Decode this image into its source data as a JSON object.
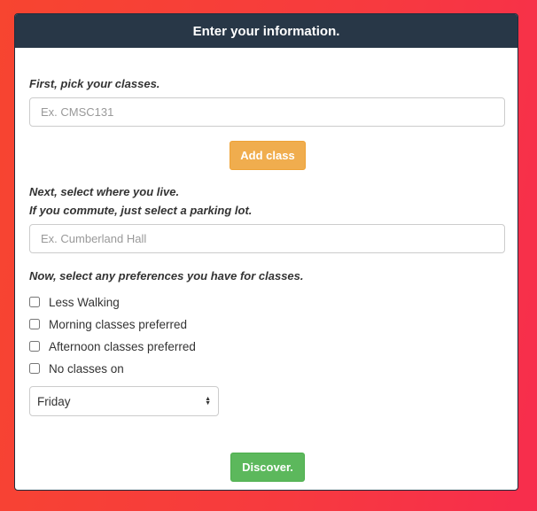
{
  "form": {
    "title": "Enter your information.",
    "classes_label": "First, pick your classes.",
    "classes_placeholder": "Ex. CMSC131",
    "add_class_label": "Add class",
    "residence_label_line1": "Next, select where you live.",
    "residence_label_line2": "If you commute, just select a parking lot.",
    "residence_placeholder": "Ex. Cumberland Hall",
    "preferences_label": "Now, select any preferences you have for classes.",
    "preferences": [
      {
        "label": "Less Walking",
        "checked": false
      },
      {
        "label": "Morning classes preferred",
        "checked": false
      },
      {
        "label": "Afternoon classes preferred",
        "checked": false
      },
      {
        "label": "No classes on",
        "checked": false
      }
    ],
    "day_select_value": "Friday",
    "discover_label": "Discover."
  },
  "colors": {
    "header_bg": "#283747",
    "add_button": "#f0ad4e",
    "discover_button": "#5cb85c",
    "background_left": "#f74530",
    "background_right": "#f72d4d"
  }
}
